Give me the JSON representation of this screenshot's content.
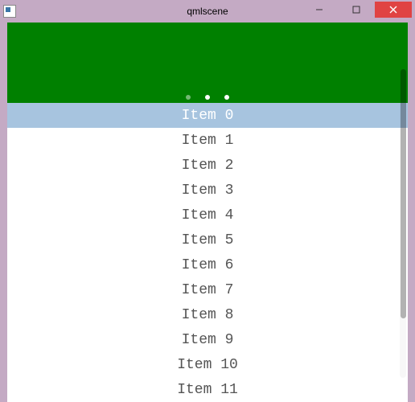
{
  "window": {
    "title": "qmlscene"
  },
  "page_indicator": {
    "count": 3,
    "current": 1
  },
  "list": {
    "selected_index": 0,
    "items": [
      {
        "label": "Item 0"
      },
      {
        "label": "Item 1"
      },
      {
        "label": "Item 2"
      },
      {
        "label": "Item 3"
      },
      {
        "label": "Item 4"
      },
      {
        "label": "Item 5"
      },
      {
        "label": "Item 6"
      },
      {
        "label": "Item 7"
      },
      {
        "label": "Item 8"
      },
      {
        "label": "Item 9"
      },
      {
        "label": "Item 10"
      },
      {
        "label": "Item 11"
      }
    ]
  }
}
